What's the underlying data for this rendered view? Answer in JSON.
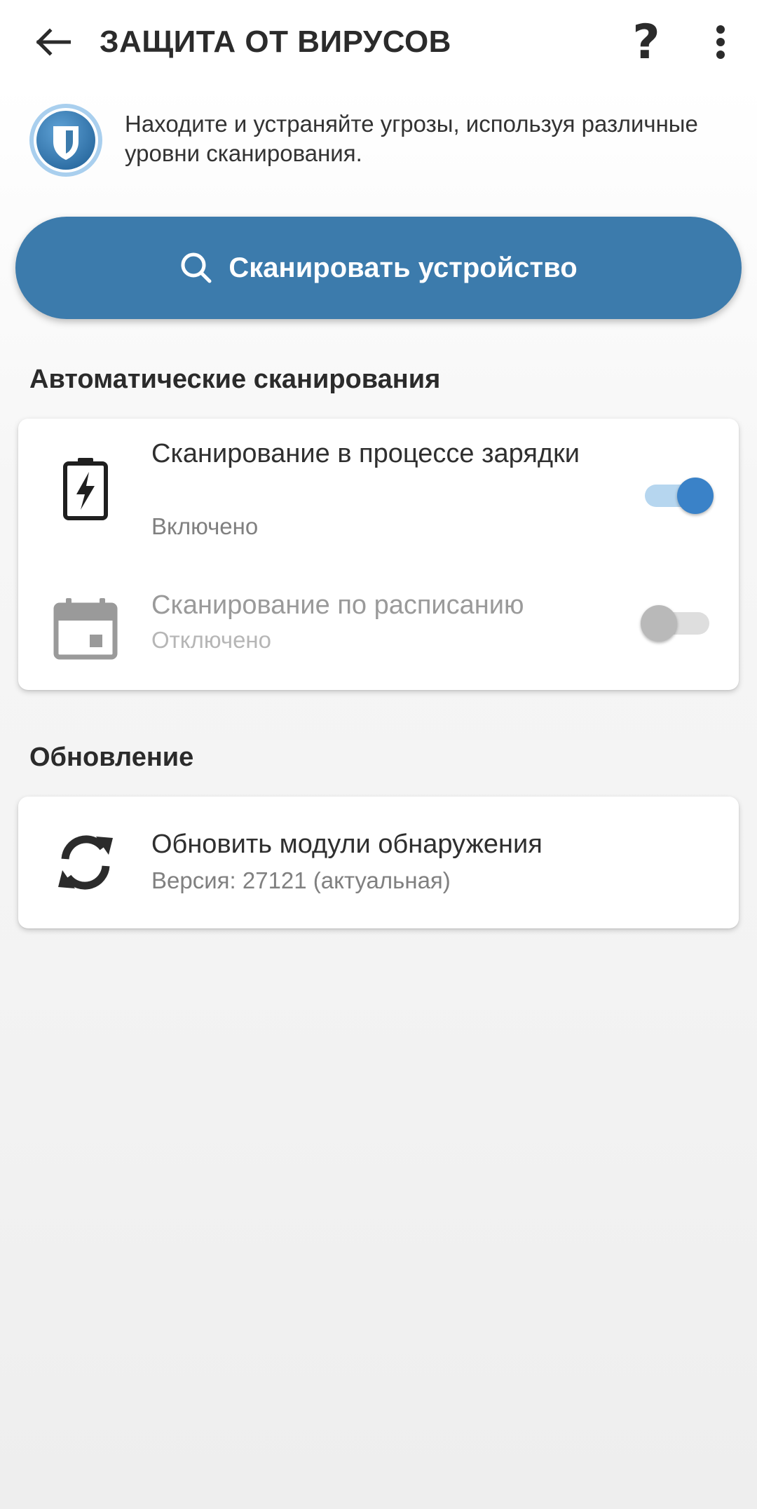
{
  "toolbar": {
    "title": "ЗАЩИТА ОТ ВИРУСОВ",
    "back_icon": "arrow-left-icon",
    "help_label": "?",
    "more_icon": "more-vert-icon"
  },
  "intro": {
    "logo_icon": "shield-icon",
    "text": "Находите и устраняйте угрозы, используя различные уровни сканирования."
  },
  "scan_button": {
    "label": "Сканировать устройство",
    "icon": "search-icon"
  },
  "auto_scans": {
    "section_title": "Автоматические сканирования",
    "items": [
      {
        "title": "Сканирование в процессе зарядки",
        "status": "Включено",
        "enabled": true,
        "icon": "battery-charging-icon"
      },
      {
        "title": "Сканирование по расписанию",
        "status": "Отключено",
        "enabled": false,
        "icon": "calendar-icon"
      }
    ]
  },
  "update": {
    "section_title": "Обновление",
    "title": "Обновить модули обнаружения",
    "status": "Версия: 27121 (актуальная)",
    "icon": "sync-icon"
  },
  "colors": {
    "accent": "#3c7bac",
    "toggle_on_thumb": "#3a82c8",
    "toggle_on_track": "#b6d6ef",
    "toggle_off_thumb": "#b9b9b9",
    "toggle_off_track": "#dedede"
  }
}
